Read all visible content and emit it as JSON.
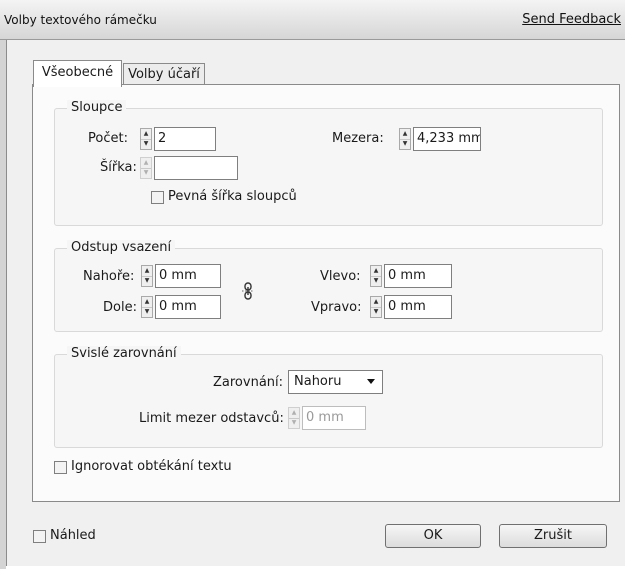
{
  "window": {
    "title": "Volby textového rámečku",
    "feedback_link": "Send Feedback"
  },
  "tabs": [
    {
      "label": "Všeobecné",
      "active": true
    },
    {
      "label": "Volby účaří",
      "active": false
    }
  ],
  "columns": {
    "legend": "Sloupce",
    "count_label": "Počet:",
    "count_value": "2",
    "gutter_label": "Mezera:",
    "gutter_value": "4,233 mm",
    "width_label": "Šířka:",
    "width_value": "",
    "fixed_width_label": "Pevná šířka sloupců",
    "fixed_width_checked": false
  },
  "inset": {
    "legend": "Odstup vsazení",
    "top_label": "Nahoře:",
    "top_value": "0 mm",
    "bottom_label": "Dole:",
    "bottom_value": "0 mm",
    "left_label": "Vlevo:",
    "left_value": "0 mm",
    "right_label": "Vpravo:",
    "right_value": "0 mm",
    "link_icon": "chain-link-icon"
  },
  "vertical": {
    "legend": "Svislé zarovnání",
    "align_label": "Zarovnání:",
    "align_value": "Nahoru",
    "limit_label": "Limit mezer odstavců:",
    "limit_value": "0 mm"
  },
  "ignore_wrap": {
    "label": "Ignorovat obtékání textu",
    "checked": false
  },
  "footer": {
    "preview_label": "Náhled",
    "preview_checked": false,
    "ok_label": "OK",
    "cancel_label": "Zrušit"
  }
}
